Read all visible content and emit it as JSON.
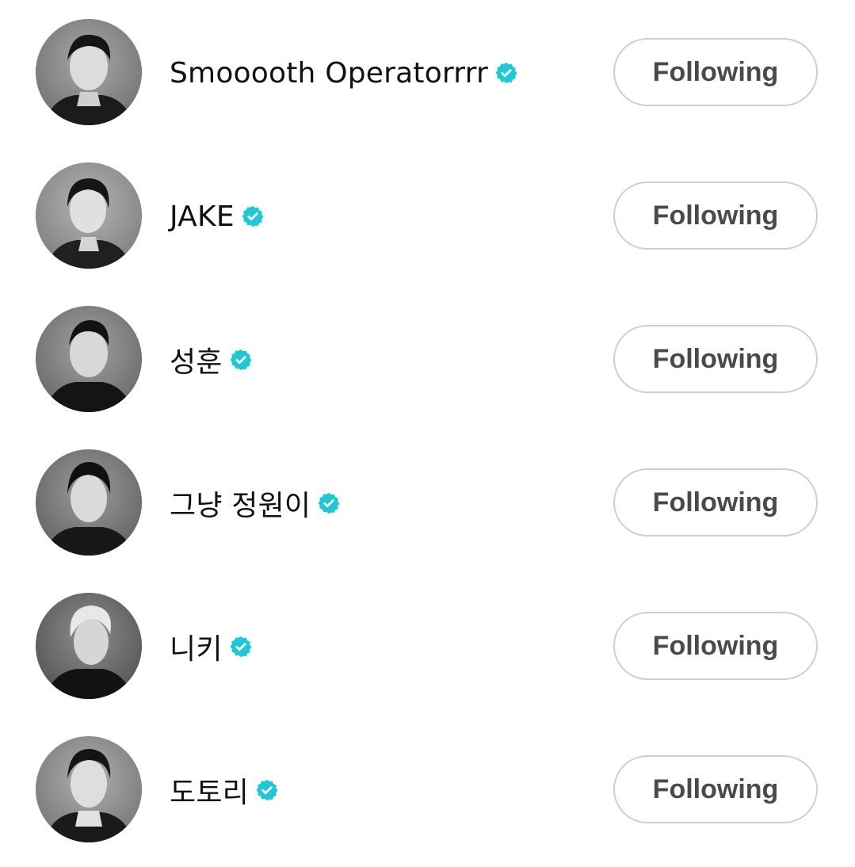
{
  "colors": {
    "verified": "#1ec8d4",
    "button_border": "#cfcfcf",
    "button_text": "#4a4a4a",
    "name_text": "#111111"
  },
  "accounts": [
    {
      "name": "Smooooth Operatorrrr",
      "verified_icon": "verified-badge-icon",
      "button_label": "Following"
    },
    {
      "name": "JAKE",
      "verified_icon": "verified-badge-icon",
      "button_label": "Following"
    },
    {
      "name": "성훈",
      "verified_icon": "verified-badge-icon",
      "button_label": "Following"
    },
    {
      "name": "그냥 정원이",
      "verified_icon": "verified-badge-icon",
      "button_label": "Following"
    },
    {
      "name": "니키",
      "verified_icon": "verified-badge-icon",
      "button_label": "Following"
    },
    {
      "name": "도토리",
      "verified_icon": "verified-badge-icon",
      "button_label": "Following"
    }
  ]
}
